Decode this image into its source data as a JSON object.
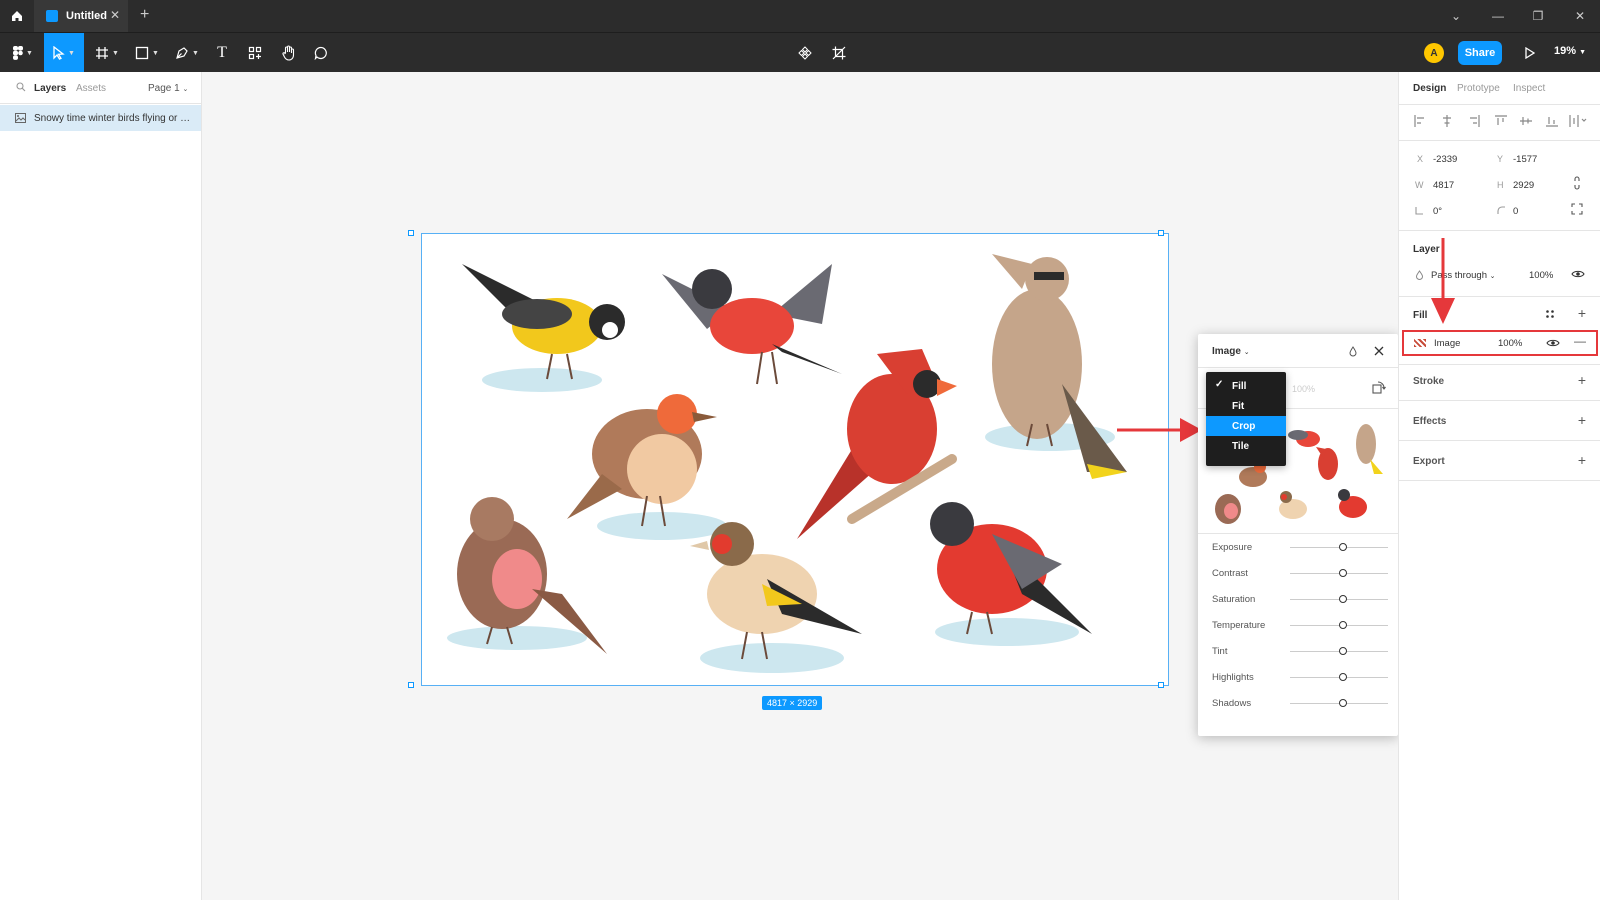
{
  "window": {
    "tab_title": "Untitled",
    "tab_close": "✕",
    "new_tab": "+",
    "controls": {
      "dropdown": "⌄",
      "minimize": "—",
      "restore": "❐",
      "close": "✕"
    }
  },
  "toolbar": {
    "share_label": "Share",
    "zoom_label": "19%",
    "avatar_initial": "A",
    "text_tool_label": "T"
  },
  "left_panel": {
    "tabs": [
      "Layers",
      "Assets"
    ],
    "page_selector": "Page 1",
    "layers": [
      {
        "name": "Snowy time winter birds flying or h...",
        "icon": "image-icon",
        "selected": true
      }
    ]
  },
  "canvas": {
    "dimension_badge": "4817 × 2929",
    "help_label": "?"
  },
  "image_popover": {
    "title": "Image",
    "opacity_placeholder": "100%",
    "scale_modes": [
      {
        "label": "Fill",
        "checked": true,
        "hover": false
      },
      {
        "label": "Fit",
        "checked": false,
        "hover": false
      },
      {
        "label": "Crop",
        "checked": false,
        "hover": true
      },
      {
        "label": "Tile",
        "checked": false,
        "hover": false
      }
    ],
    "adjustments": [
      {
        "label": "Exposure",
        "value": 0
      },
      {
        "label": "Contrast",
        "value": 0
      },
      {
        "label": "Saturation",
        "value": 0
      },
      {
        "label": "Temperature",
        "value": 0
      },
      {
        "label": "Tint",
        "value": 0
      },
      {
        "label": "Highlights",
        "value": 0
      },
      {
        "label": "Shadows",
        "value": 0
      }
    ]
  },
  "right_panel": {
    "tabs": [
      "Design",
      "Prototype",
      "Inspect"
    ],
    "active_tab": "Design",
    "position": {
      "x_label": "X",
      "x": "-2339",
      "y_label": "Y",
      "y": "-1577"
    },
    "size": {
      "w_label": "W",
      "w": "4817",
      "h_label": "H",
      "h": "2929"
    },
    "rotation": "0°",
    "corner_radius": "0",
    "layer": {
      "title": "Layer",
      "blend_mode": "Pass through",
      "opacity": "100%"
    },
    "fill": {
      "title": "Fill",
      "type": "Image",
      "opacity": "100%"
    },
    "stroke_title": "Stroke",
    "effects_title": "Effects",
    "export_title": "Export"
  },
  "colors": {
    "accent": "#0d99ff",
    "annotation_red": "#e5383b",
    "dark_chrome": "#2c2c2c"
  }
}
